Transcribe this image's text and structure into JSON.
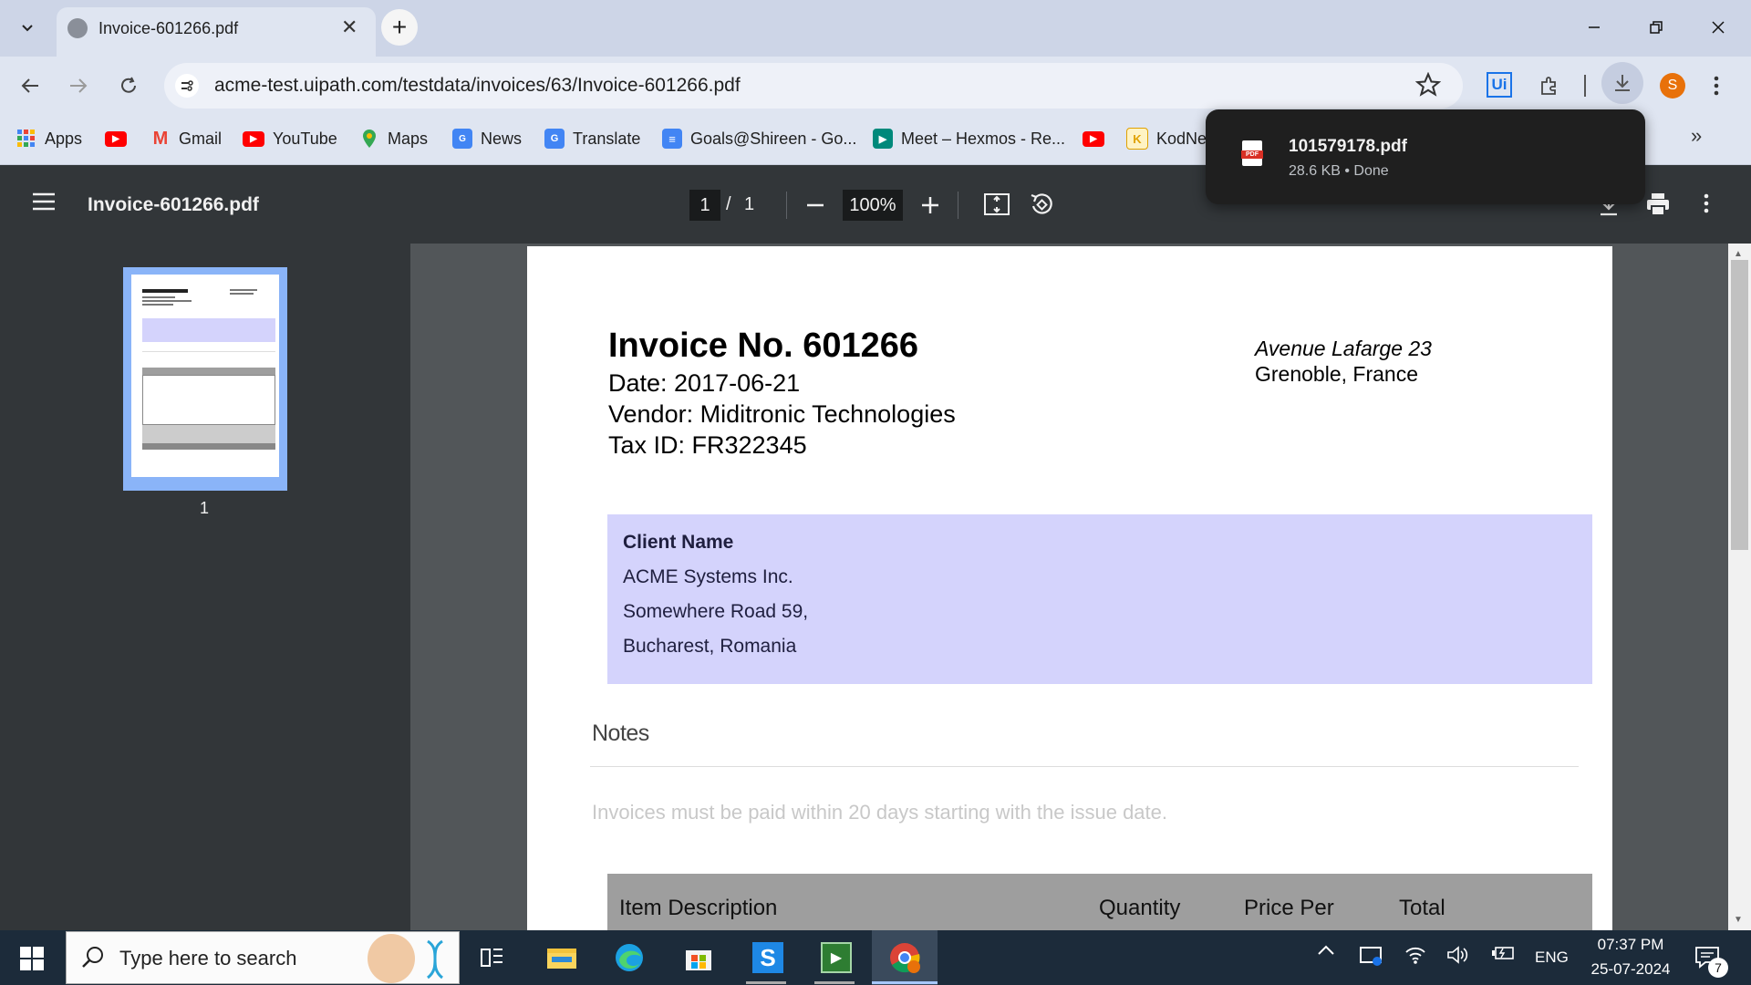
{
  "browser": {
    "tab_title": "Invoice-601266.pdf",
    "url": "acme-test.uipath.com/testdata/invoices/63/Invoice-601266.pdf",
    "profile_initial": "S",
    "extension_label": "Ui"
  },
  "bookmarks": [
    {
      "label": "Apps",
      "icon": "apps-grid-icon"
    },
    {
      "label": "",
      "icon": "youtube-icon"
    },
    {
      "label": "Gmail",
      "icon": "gmail-icon"
    },
    {
      "label": "YouTube",
      "icon": "youtube-icon"
    },
    {
      "label": "Maps",
      "icon": "maps-pin-icon"
    },
    {
      "label": "News",
      "icon": "news-icon"
    },
    {
      "label": "Translate",
      "icon": "translate-icon"
    },
    {
      "label": "Goals@Shireen - Go...",
      "icon": "docs-icon"
    },
    {
      "label": "Meet – Hexmos - Re...",
      "icon": "meet-icon"
    },
    {
      "label": "",
      "icon": "youtube-icon"
    },
    {
      "label": "KodNe",
      "icon": "kodnest-icon"
    }
  ],
  "download": {
    "filename": "101579178.pdf",
    "status": "28.6 KB • Done",
    "file_icon_label": "PDF"
  },
  "pdf_viewer": {
    "title": "Invoice-601266.pdf",
    "current_page": "1",
    "page_separator": "/",
    "total_pages": "1",
    "zoom": "100%",
    "thumbnail_page_label": "1"
  },
  "invoice": {
    "title": "Invoice No. 601266",
    "date": "Date: 2017-06-21",
    "vendor": "Vendor: Miditronic Technologies",
    "tax_id": "Tax ID: FR322345",
    "address_line1": "Avenue Lafarge 23",
    "address_line2": "Grenoble, France",
    "client_heading": "Client Name",
    "client_name": "ACME Systems Inc.",
    "client_street": "Somewhere Road 59,",
    "client_city": "Bucharest, Romania",
    "notes_heading": "Notes",
    "notes_text": "Invoices must be paid within 20 days starting with the issue date.",
    "table_headers": [
      "Item Description",
      "Quantity",
      "Price Per",
      "Total"
    ]
  },
  "taskbar": {
    "search_placeholder": "Type here to search",
    "language": "ENG",
    "time": "07:37 PM",
    "date": "25-07-2024",
    "notification_count": "7"
  },
  "colors": {
    "client_box": "#d4d3fc",
    "table_header": "#9e9e9e",
    "pdf_toolbar": "#323639",
    "viewer_bg": "#525659",
    "profile_orange": "#e8710a"
  }
}
